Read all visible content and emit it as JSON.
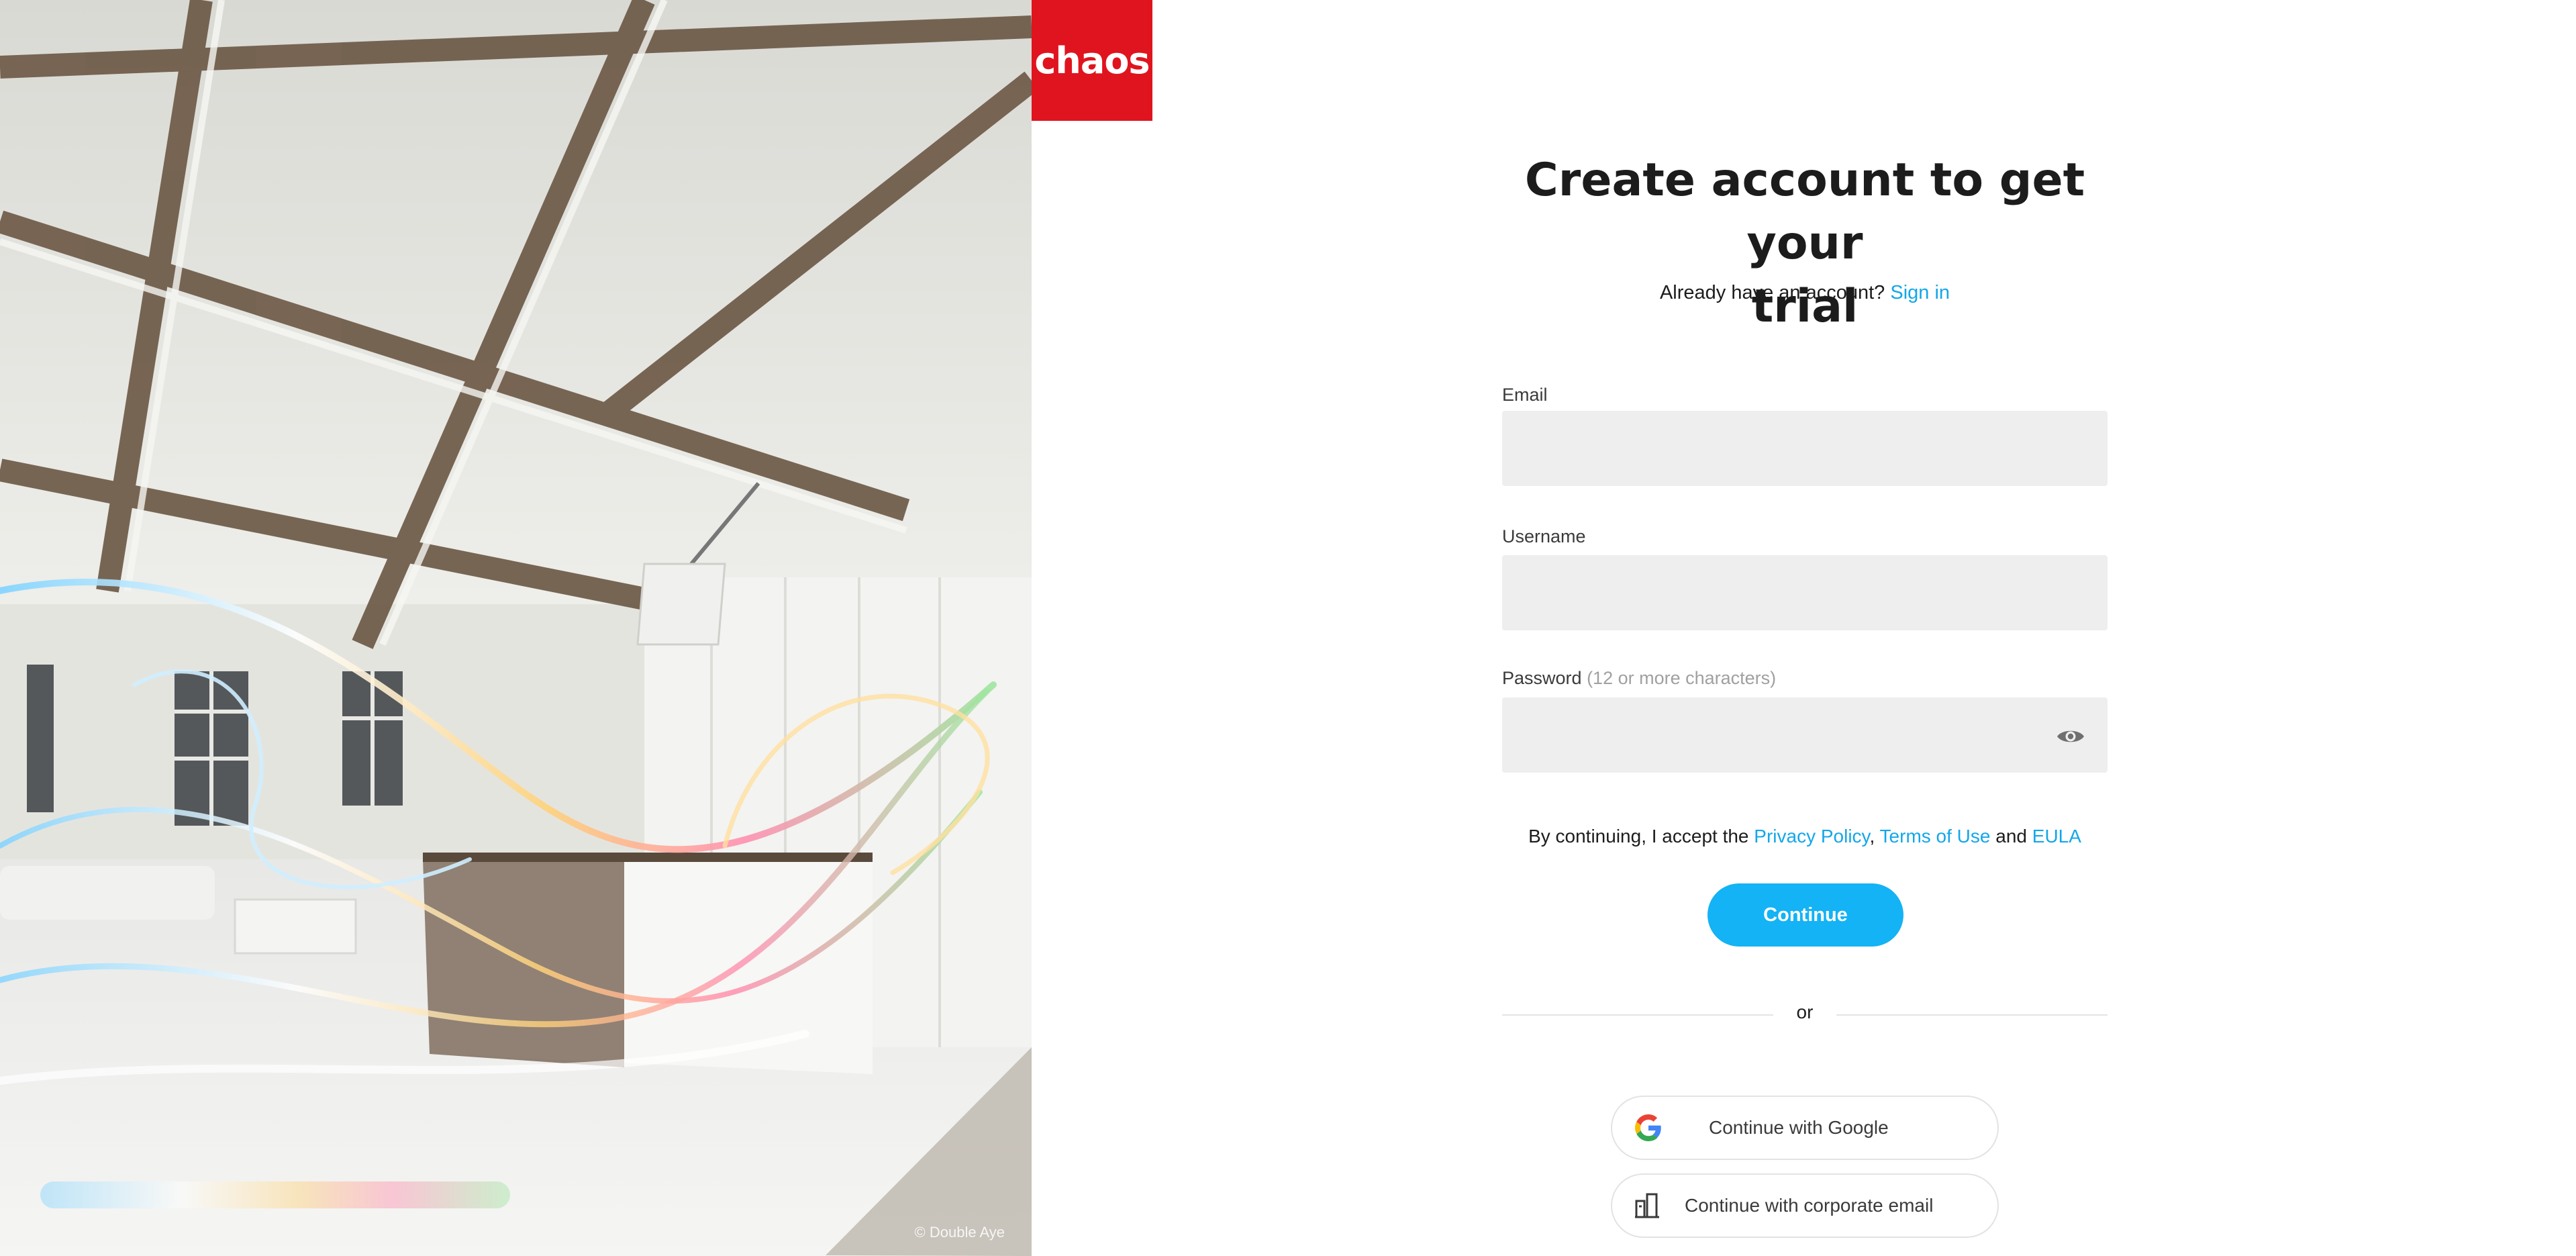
{
  "hero": {
    "credit": "© Double Aye"
  },
  "logo": {
    "text": "chaos",
    "background": "#e0141e"
  },
  "heading": {
    "title_line1": "Create account to get your",
    "title_line2": "trial"
  },
  "signin": {
    "prompt": "Already have an account?",
    "link": "Sign in"
  },
  "form": {
    "email": {
      "label": "Email",
      "value": "",
      "placeholder": ""
    },
    "username": {
      "label": "Username",
      "value": "",
      "placeholder": ""
    },
    "password": {
      "label": "Password",
      "hint": "(12 or more characters)",
      "value": "",
      "placeholder": "",
      "toggle_icon": "eye-icon"
    }
  },
  "terms": {
    "prefix": "By continuing, I accept the",
    "privacy": "Privacy Policy",
    "comma": ",",
    "terms_of_use": "Terms of Use",
    "and": "and",
    "eula": "EULA"
  },
  "actions": {
    "continue_label": "Continue",
    "divider": "or",
    "google_label": "Continue with Google",
    "google_icon": "google-icon",
    "corporate_label": "Continue with corporate email",
    "corporate_icon": "building-icon"
  },
  "colors": {
    "accent": "#13b3f5",
    "link": "#13a7e8",
    "brand_red": "#e0141e",
    "input_bg": "#eeeeef"
  }
}
